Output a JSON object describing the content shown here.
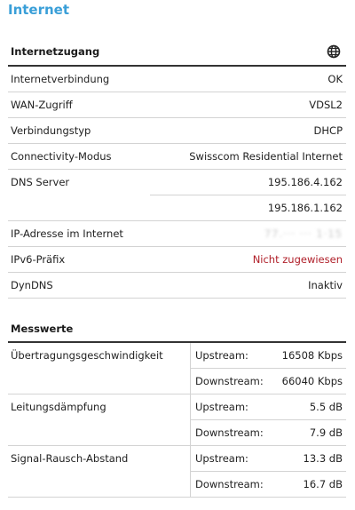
{
  "page": {
    "title": "Internet"
  },
  "access": {
    "title": "Internetzugang",
    "icon": "globe-icon",
    "rows": [
      {
        "label": "Internetverbindung",
        "value": "OK"
      },
      {
        "label": "WAN-Zugriff",
        "value": "VDSL2"
      },
      {
        "label": "Verbindungstyp",
        "value": "DHCP"
      },
      {
        "label": "Connectivity-Modus",
        "value": "Swisscom Residential Internet"
      }
    ],
    "dns": {
      "label": "DNS Server",
      "values": [
        "195.186.4.162",
        "195.186.1.162"
      ]
    },
    "ip": {
      "label": "IP-Adresse im Internet",
      "value": "77.··· ··· 1·15"
    },
    "ipv6": {
      "label": "IPv6-Präfix",
      "value": "Nicht zugewiesen"
    },
    "dyndns": {
      "label": "DynDNS",
      "value": "Inaktiv"
    }
  },
  "measurements": {
    "title": "Messwerte",
    "rows": [
      {
        "label": "Übertragungsgeschwindigkeit",
        "up_label": "Upstream:",
        "up": "16508 Kbps",
        "down_label": "Downstream:",
        "down": "66040 Kbps"
      },
      {
        "label": "Leitungsdämpfung",
        "up_label": "Upstream:",
        "up": "5.5 dB",
        "down_label": "Downstream:",
        "down": "7.9 dB"
      },
      {
        "label": "Signal-Rausch-Abstand",
        "up_label": "Upstream:",
        "up": "13.3 dB",
        "down_label": "Downstream:",
        "down": "16.7 dB"
      }
    ]
  },
  "colors": {
    "title": "#3a9fd8",
    "warning": "#b0202a"
  }
}
